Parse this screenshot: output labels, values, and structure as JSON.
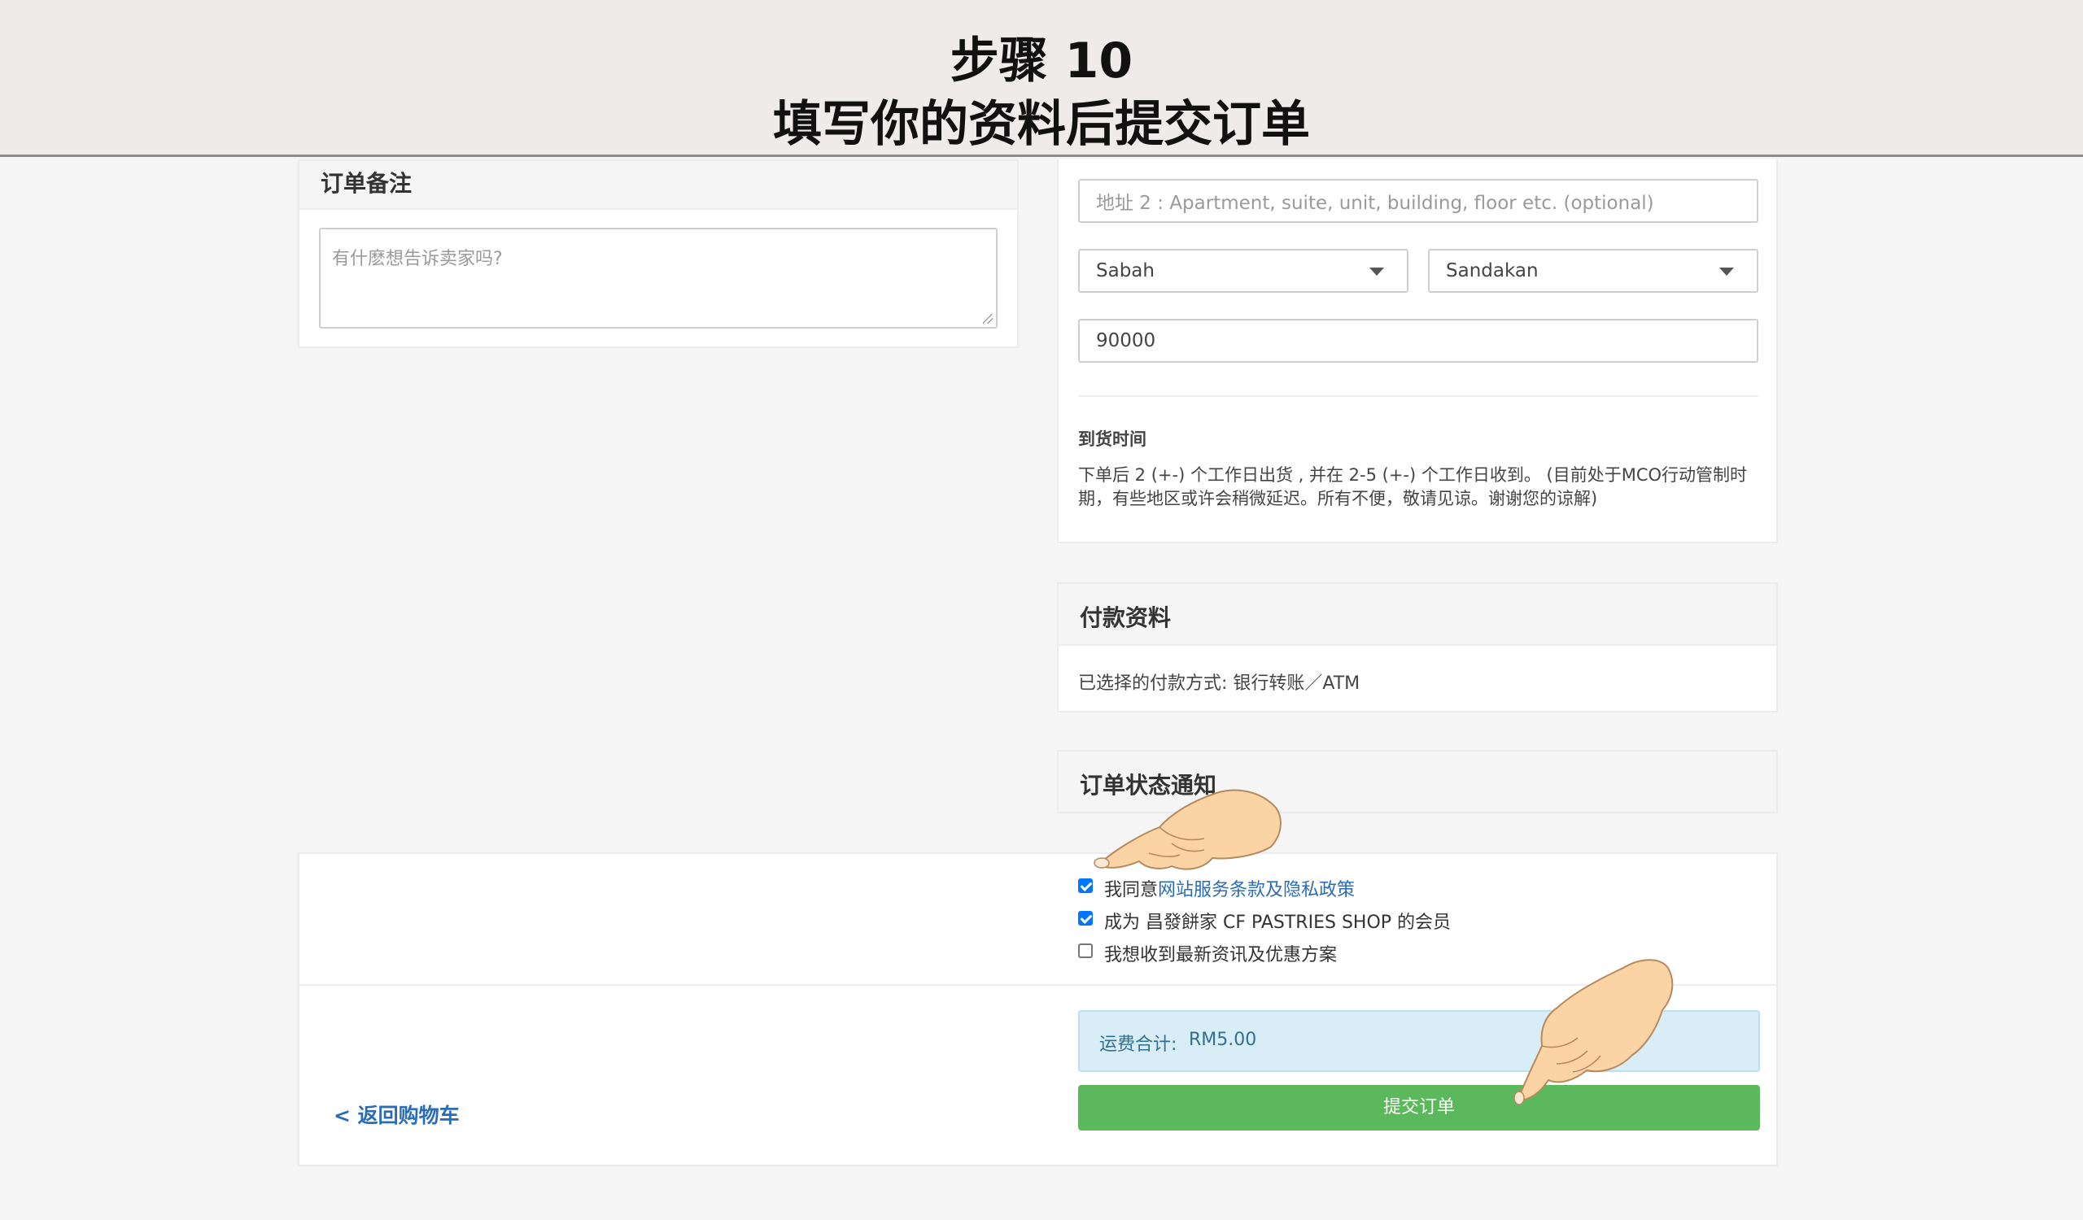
{
  "banner": {
    "line1": "步骤 10",
    "line2": "填写你的资料后提交订单"
  },
  "order_notes": {
    "title": "订单备注",
    "placeholder": "有什麽想告诉卖家吗?"
  },
  "address": {
    "address2_placeholder": "地址 2 : Apartment, suite, unit, building, floor etc. (optional)",
    "state": "Sabah",
    "city": "Sandakan",
    "postcode": "90000"
  },
  "delivery": {
    "label": "到货时间",
    "line1": "下单后 2 (+-) 个工作日出货 , 并在 2-5 (+-) 个工作日收到。 (目前处于MCO行动管制时",
    "line2": "期，有些地区或许会稍微延迟。所有不便，敬请见谅。谢谢您的谅解)"
  },
  "payment": {
    "title": "付款资料",
    "method_text": "已选择的付款方式: 银行转账／ATM"
  },
  "notification": {
    "title": "订单状态通知"
  },
  "checkboxes": {
    "agree_prefix": "我同意",
    "agree_link": "网站服务条款及隐私政策",
    "agree_checked": true,
    "member_label": "成为 昌發餅家 CF PASTRIES SHOP 的会员",
    "member_checked": true,
    "newsletter_label": "我想收到最新资讯及优惠方案",
    "newsletter_checked": false
  },
  "shipping": {
    "label": "运费合计:",
    "amount": "RM5.00"
  },
  "actions": {
    "back": "< 返回购物车",
    "submit": "提交订单"
  },
  "colors": {
    "submit_bg": "#5cb85c",
    "info_bg": "#d9edf7",
    "link": "#2b6cb7",
    "checkbox": "#0075ff"
  }
}
